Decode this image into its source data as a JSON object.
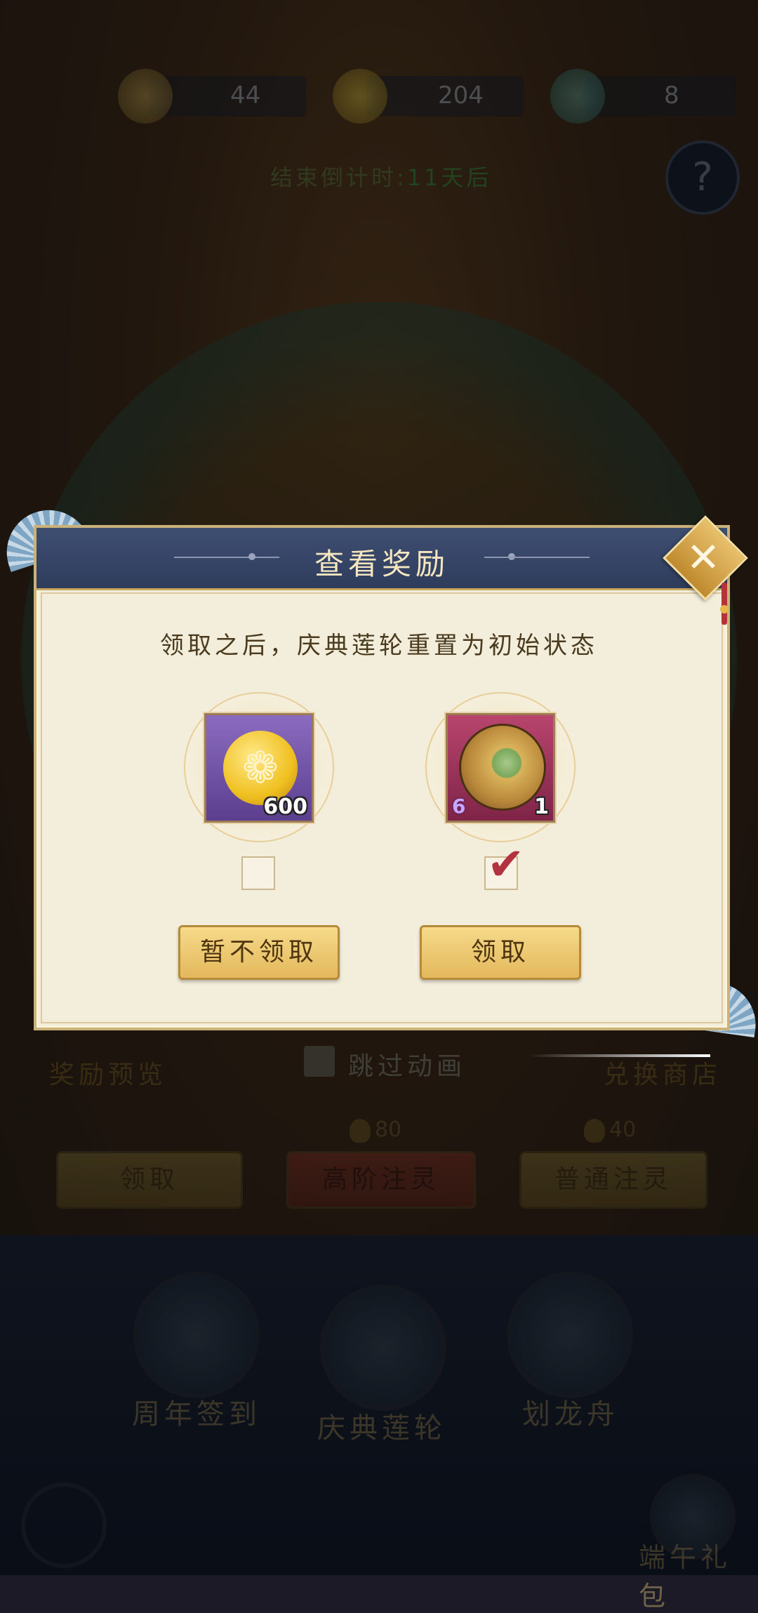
{
  "top_bar": {
    "currency_1": "44",
    "currency_2": "204",
    "currency_3": "8",
    "timer_label": "结束倒计时:",
    "timer_value": "11天后"
  },
  "help_glyph": "?",
  "main": {
    "reward_preview": "奖励预览",
    "skip_animation": "跳过动画",
    "exchange_shop": "兑换商店",
    "cost_high": "80",
    "cost_normal": "40",
    "claim_button": "领取",
    "high_infuse_button": "高阶注灵",
    "normal_infuse_button": "普通注灵"
  },
  "bottom_nav": {
    "anniversary_checkin": "周年签到",
    "celebration_wheel": "庆典莲轮",
    "dragon_boat": "划龙舟",
    "festival_gift": "端午礼包"
  },
  "dialog": {
    "title": "查看奖励",
    "message": "领取之后，庆典莲轮重置为初始状态",
    "items": [
      {
        "icon": "gold-coin-icon",
        "quantity": "600",
        "checked": false
      },
      {
        "icon": "jade-amulet-icon",
        "quantity": "1",
        "stars": "6",
        "checked": true
      }
    ],
    "decline_button": "暂不领取",
    "claim_button": "领取",
    "close_glyph": "✕"
  },
  "colors": {
    "dialog_bg": "#f3eedc",
    "header_bg": "#3e4f72",
    "gold_button": "#e3b85c",
    "check_red": "#b23240"
  }
}
